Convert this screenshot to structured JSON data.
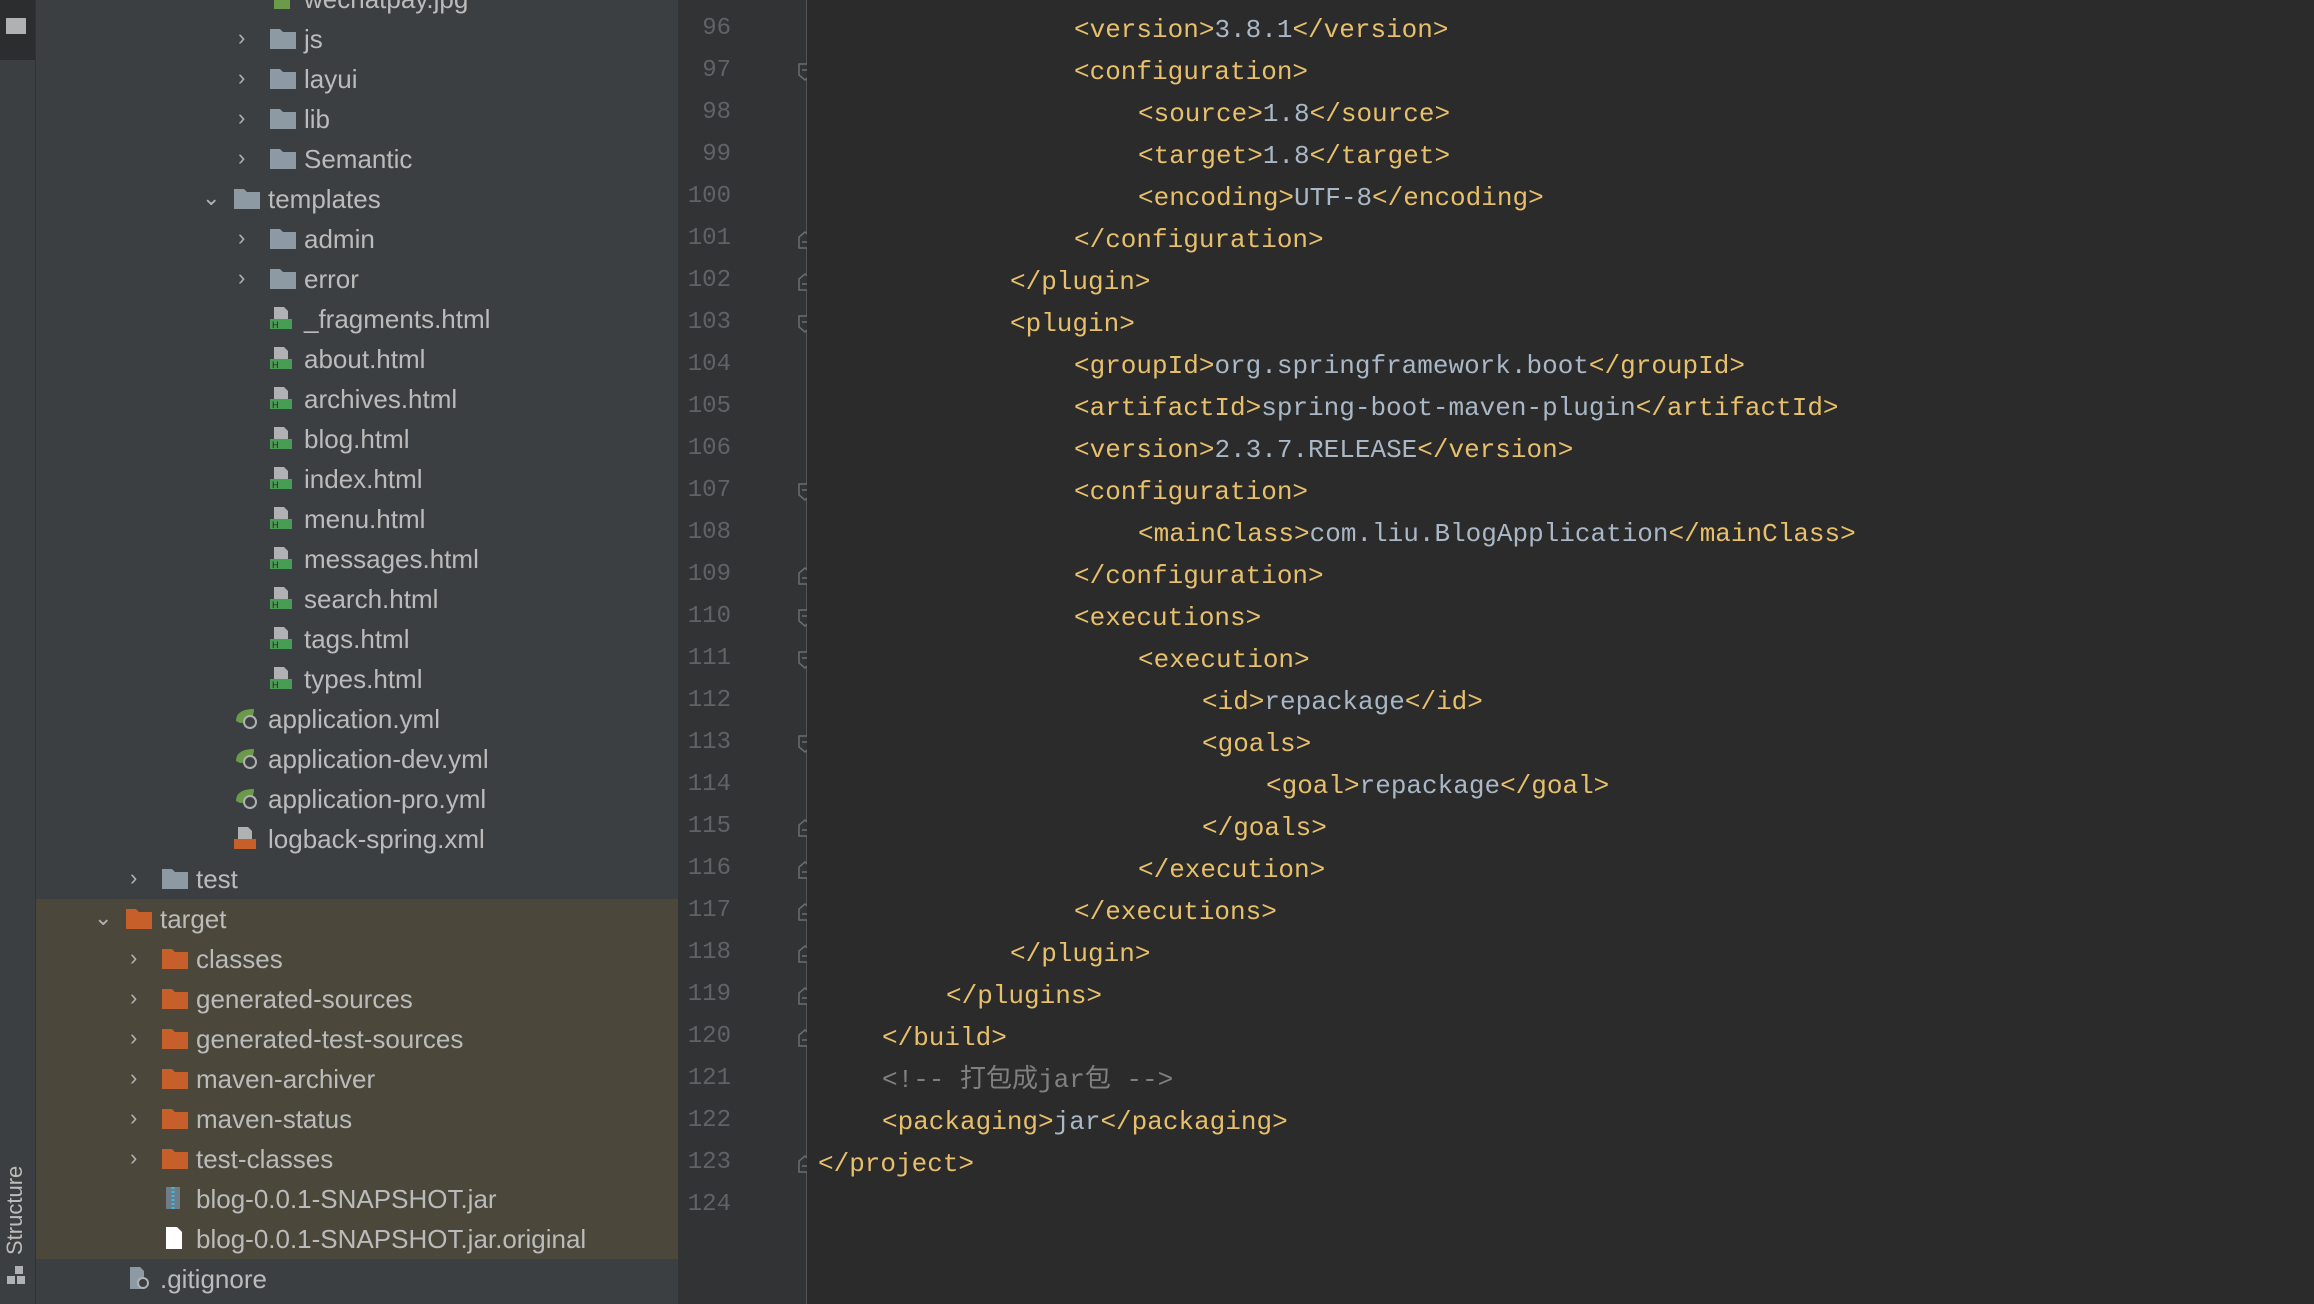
{
  "tool_strip": {
    "structure_label": "Structure"
  },
  "colors": {
    "tag": "#e8bf6a",
    "text": "#a9b7c6",
    "comment": "#808080",
    "excluded_folder": "#c75f2a",
    "folder": "#8e9aa3",
    "highlight": "#4b473b"
  },
  "tree": [
    {
      "name": "wechatpay.jpg",
      "level": 4,
      "type": "image"
    },
    {
      "name": "js",
      "level": 4,
      "type": "folder",
      "state": "collapsed"
    },
    {
      "name": "layui",
      "level": 4,
      "type": "folder",
      "state": "collapsed"
    },
    {
      "name": "lib",
      "level": 4,
      "type": "folder",
      "state": "collapsed"
    },
    {
      "name": "Semantic",
      "level": 4,
      "type": "folder",
      "state": "collapsed"
    },
    {
      "name": "templates",
      "level": 3,
      "type": "folder",
      "state": "expanded"
    },
    {
      "name": "admin",
      "level": 4,
      "type": "folder",
      "state": "collapsed"
    },
    {
      "name": "error",
      "level": 4,
      "type": "folder",
      "state": "collapsed"
    },
    {
      "name": "_fragments.html",
      "level": 4,
      "type": "html"
    },
    {
      "name": "about.html",
      "level": 4,
      "type": "html"
    },
    {
      "name": "archives.html",
      "level": 4,
      "type": "html"
    },
    {
      "name": "blog.html",
      "level": 4,
      "type": "html"
    },
    {
      "name": "index.html",
      "level": 4,
      "type": "html"
    },
    {
      "name": "menu.html",
      "level": 4,
      "type": "html"
    },
    {
      "name": "messages.html",
      "level": 4,
      "type": "html"
    },
    {
      "name": "search.html",
      "level": 4,
      "type": "html"
    },
    {
      "name": "tags.html",
      "level": 4,
      "type": "html"
    },
    {
      "name": "types.html",
      "level": 4,
      "type": "html"
    },
    {
      "name": "application.yml",
      "level": 3,
      "type": "yml"
    },
    {
      "name": "application-dev.yml",
      "level": 3,
      "type": "yml"
    },
    {
      "name": "application-pro.yml",
      "level": 3,
      "type": "yml"
    },
    {
      "name": "logback-spring.xml",
      "level": 3,
      "type": "xml"
    },
    {
      "name": "test",
      "level": 1,
      "type": "folder",
      "state": "collapsed"
    },
    {
      "name": "target",
      "level": 0,
      "type": "excluded",
      "state": "expanded",
      "highlight": true
    },
    {
      "name": "classes",
      "level": 1,
      "type": "excluded",
      "state": "collapsed",
      "highlight": true
    },
    {
      "name": "generated-sources",
      "level": 1,
      "type": "excluded",
      "state": "collapsed",
      "highlight": true
    },
    {
      "name": "generated-test-sources",
      "level": 1,
      "type": "excluded",
      "state": "collapsed",
      "highlight": true
    },
    {
      "name": "maven-archiver",
      "level": 1,
      "type": "excluded",
      "state": "collapsed",
      "highlight": true
    },
    {
      "name": "maven-status",
      "level": 1,
      "type": "excluded",
      "state": "collapsed",
      "highlight": true
    },
    {
      "name": "test-classes",
      "level": 1,
      "type": "excluded",
      "state": "collapsed",
      "highlight": true
    },
    {
      "name": "blog-0.0.1-SNAPSHOT.jar",
      "level": 1,
      "type": "jar",
      "highlight": true
    },
    {
      "name": "blog-0.0.1-SNAPSHOT.jar.original",
      "level": 1,
      "type": "file",
      "highlight": true
    },
    {
      "name": ".gitignore",
      "level": 0,
      "type": "gitignore"
    }
  ],
  "code": [
    {
      "n": "96",
      "i": 4,
      "tokens": [
        [
          "t",
          "<version>"
        ],
        [
          "v",
          "3.8.1"
        ],
        [
          "t",
          "</version>"
        ]
      ]
    },
    {
      "n": "97",
      "i": 4,
      "fold": "open",
      "tokens": [
        [
          "t",
          "<configuration>"
        ]
      ]
    },
    {
      "n": "98",
      "i": 5,
      "tokens": [
        [
          "t",
          "<source>"
        ],
        [
          "v",
          "1.8"
        ],
        [
          "t",
          "</source>"
        ]
      ]
    },
    {
      "n": "99",
      "i": 5,
      "tokens": [
        [
          "t",
          "<target>"
        ],
        [
          "v",
          "1.8"
        ],
        [
          "t",
          "</target>"
        ]
      ]
    },
    {
      "n": "100",
      "i": 5,
      "tokens": [
        [
          "t",
          "<encoding>"
        ],
        [
          "v",
          "UTF-8"
        ],
        [
          "t",
          "</encoding>"
        ]
      ]
    },
    {
      "n": "101",
      "i": 4,
      "fold": "close",
      "tokens": [
        [
          "t",
          "</configuration>"
        ]
      ]
    },
    {
      "n": "102",
      "i": 3,
      "fold": "close",
      "tokens": [
        [
          "t",
          "</plugin>"
        ]
      ]
    },
    {
      "n": "103",
      "i": 3,
      "fold": "open",
      "tokens": [
        [
          "t",
          "<plugin>"
        ]
      ]
    },
    {
      "n": "104",
      "i": 4,
      "tokens": [
        [
          "t",
          "<groupId>"
        ],
        [
          "v",
          "org.springframework.boot"
        ],
        [
          "t",
          "</groupId>"
        ]
      ]
    },
    {
      "n": "105",
      "i": 4,
      "tokens": [
        [
          "t",
          "<artifactId>"
        ],
        [
          "v",
          "spring-boot-maven-plugin"
        ],
        [
          "t",
          "</artifactId>"
        ]
      ]
    },
    {
      "n": "106",
      "i": 4,
      "tokens": [
        [
          "t",
          "<version>"
        ],
        [
          "v",
          "2.3.7.RELEASE"
        ],
        [
          "t",
          "</version>"
        ]
      ]
    },
    {
      "n": "107",
      "i": 4,
      "fold": "open",
      "tokens": [
        [
          "t",
          "<configuration>"
        ]
      ]
    },
    {
      "n": "108",
      "i": 5,
      "tokens": [
        [
          "t",
          "<mainClass>"
        ],
        [
          "v",
          "com.liu.BlogApplication"
        ],
        [
          "t",
          "</mainClass>"
        ]
      ]
    },
    {
      "n": "109",
      "i": 4,
      "fold": "close",
      "tokens": [
        [
          "t",
          "</configuration>"
        ]
      ]
    },
    {
      "n": "110",
      "i": 4,
      "fold": "open",
      "tokens": [
        [
          "t",
          "<executions>"
        ]
      ]
    },
    {
      "n": "111",
      "i": 5,
      "fold": "open",
      "tokens": [
        [
          "t",
          "<execution>"
        ]
      ]
    },
    {
      "n": "112",
      "i": 6,
      "tokens": [
        [
          "t",
          "<id>"
        ],
        [
          "v",
          "repackage"
        ],
        [
          "t",
          "</id>"
        ]
      ]
    },
    {
      "n": "113",
      "i": 6,
      "fold": "open",
      "tokens": [
        [
          "t",
          "<goals>"
        ]
      ]
    },
    {
      "n": "114",
      "i": 7,
      "tokens": [
        [
          "t",
          "<goal>"
        ],
        [
          "v",
          "repackage"
        ],
        [
          "t",
          "</goal>"
        ]
      ]
    },
    {
      "n": "115",
      "i": 6,
      "fold": "close",
      "tokens": [
        [
          "t",
          "</goals>"
        ]
      ]
    },
    {
      "n": "116",
      "i": 5,
      "fold": "close",
      "tokens": [
        [
          "t",
          "</execution>"
        ]
      ]
    },
    {
      "n": "117",
      "i": 4,
      "fold": "close",
      "tokens": [
        [
          "t",
          "</executions>"
        ]
      ]
    },
    {
      "n": "118",
      "i": 3,
      "fold": "close",
      "tokens": [
        [
          "t",
          "</plugin>"
        ]
      ]
    },
    {
      "n": "119",
      "i": 2,
      "fold": "close",
      "tokens": [
        [
          "t",
          "</plugins>"
        ]
      ]
    },
    {
      "n": "120",
      "i": 1,
      "fold": "close",
      "tokens": [
        [
          "t",
          "</build>"
        ]
      ]
    },
    {
      "n": "121",
      "i": 1,
      "tokens": [
        [
          "c",
          "<!-- 打包成jar包 -->"
        ]
      ]
    },
    {
      "n": "122",
      "i": 1,
      "tokens": [
        [
          "t",
          "<packaging>"
        ],
        [
          "v",
          "jar"
        ],
        [
          "t",
          "</packaging>"
        ]
      ]
    },
    {
      "n": "123",
      "i": 0,
      "fold": "close",
      "tokens": [
        [
          "t",
          "</project>"
        ]
      ]
    },
    {
      "n": "124",
      "i": 0,
      "tokens": []
    }
  ]
}
